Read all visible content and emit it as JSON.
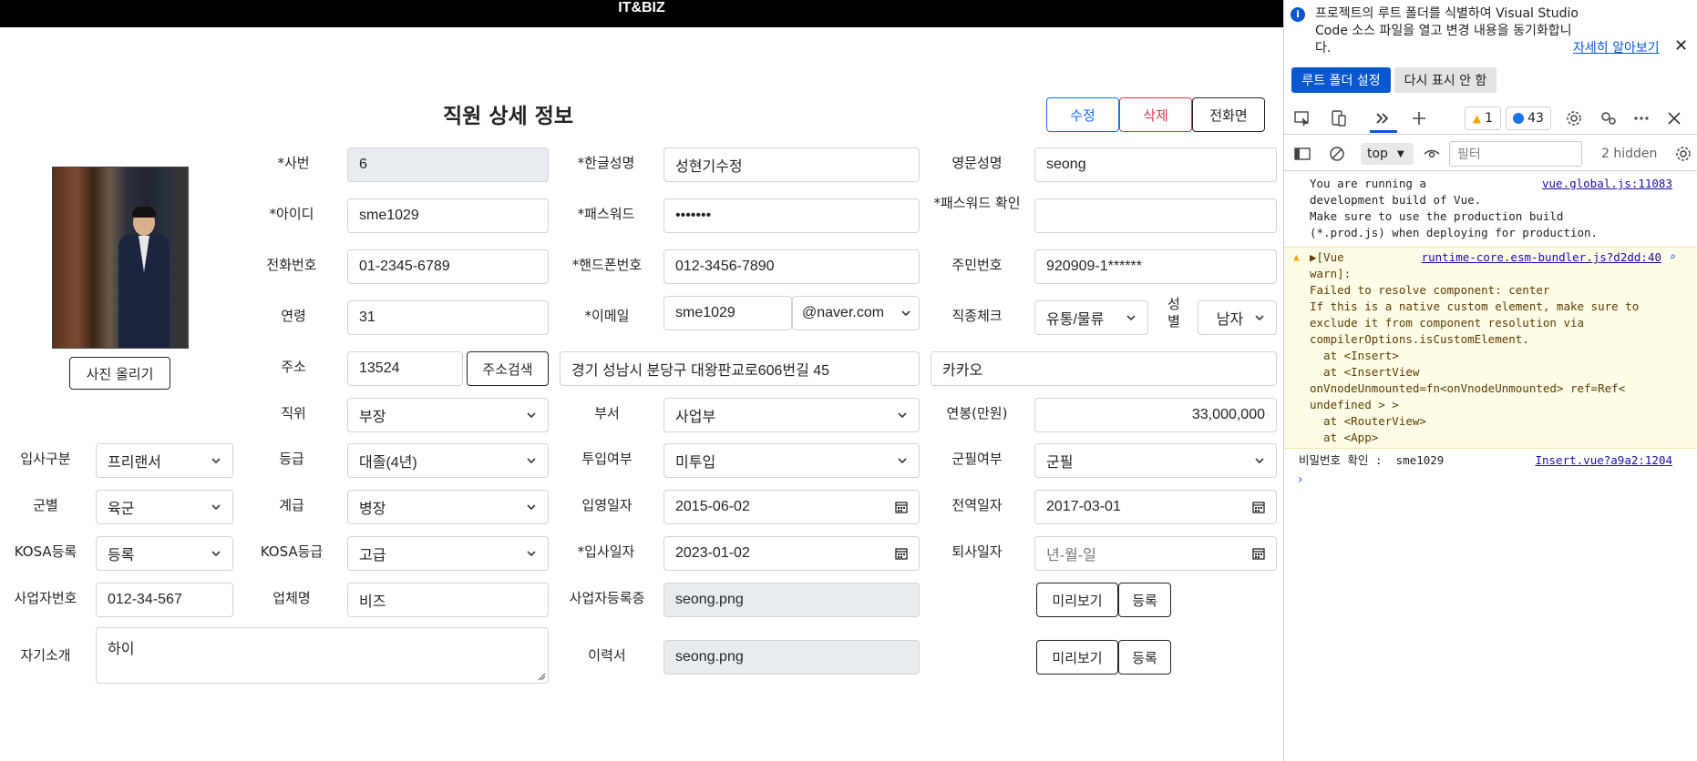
{
  "app": {
    "brand": "IT&BIZ"
  },
  "page": {
    "title": "직원 상세 정보"
  },
  "actions": {
    "edit": "수정",
    "delete": "삭제",
    "back": "전화면"
  },
  "photo": {
    "upload_label": "사진 올리기"
  },
  "form": {
    "emp_no": {
      "label": "*사번",
      "value": "6"
    },
    "name_kr": {
      "label": "*한글성명",
      "value": "성현기수정"
    },
    "name_en": {
      "label": "영문성명",
      "value": "seong"
    },
    "user_id": {
      "label": "*아이디",
      "value": "sme1029"
    },
    "password": {
      "label": "*패스워드",
      "value": "•••••••"
    },
    "password_confirm": {
      "label": "*패스워드 확인",
      "value": ""
    },
    "phone": {
      "label": "전화번호",
      "value": "01-2345-6789"
    },
    "mobile": {
      "label": "*핸드폰번호",
      "value": "012-3456-7890"
    },
    "resident_no": {
      "label": "주민번호",
      "value": "920909-1******"
    },
    "age": {
      "label": "연령",
      "value": "31"
    },
    "email": {
      "label": "*이메일",
      "value": "sme1029",
      "domain": "@naver.com"
    },
    "job_type": {
      "label": "직종체크",
      "value": "유통/물류"
    },
    "gender": {
      "label": "성별",
      "value": "남자"
    },
    "address": {
      "label": "주소",
      "zip": "13524",
      "search_label": "주소검색",
      "line1": "경기 성남시 분당구 대왕판교로606번길 45",
      "line2": "카카오"
    },
    "position": {
      "label": "직위",
      "value": "부장"
    },
    "department": {
      "label": "부서",
      "value": "사업부"
    },
    "salary": {
      "label": "연봉(만원)",
      "value": "33,000,000"
    },
    "hire_type": {
      "label": "입사구분",
      "value": "프리랜서"
    },
    "grade": {
      "label": "등급",
      "value": "대졸(4년)"
    },
    "deploy": {
      "label": "투입여부",
      "value": "미투입"
    },
    "military": {
      "label": "군필여부",
      "value": "군필"
    },
    "army_branch": {
      "label": "군별",
      "value": "육군"
    },
    "rank": {
      "label": "계급",
      "value": "병장"
    },
    "enlist_date": {
      "label": "입영일자",
      "value": "2015-06-02"
    },
    "discharge_date": {
      "label": "전역일자",
      "value": "2017-03-01"
    },
    "kosa_reg": {
      "label": "KOSA등록",
      "value": "등록"
    },
    "kosa_grade": {
      "label": "KOSA등급",
      "value": "고급"
    },
    "join_date": {
      "label": "*입사일자",
      "value": "2023-01-02"
    },
    "leave_date": {
      "label": "퇴사일자",
      "value": "년-월-일"
    },
    "biz_no": {
      "label": "사업자번호",
      "value": "012-34-567"
    },
    "company": {
      "label": "업체명",
      "value": "비즈"
    },
    "biz_cert": {
      "label": "사업자등록증",
      "value": "seong.png",
      "preview": "미리보기",
      "register": "등록"
    },
    "intro": {
      "label": "자기소개",
      "value": "하이"
    },
    "resume": {
      "label": "이력서",
      "value": "seong.png",
      "preview": "미리보기",
      "register": "등록"
    }
  },
  "devtools": {
    "infobar": {
      "message": "프로젝트의 루트 폴더를 식별하여 Visual Studio Code 소스 파일을 열고 변경 내용을 동기화합니다.",
      "learn_more": "자세히 알아보기",
      "set_root": "루트 폴더 설정",
      "dont_show": "다시 표시 안 함"
    },
    "warnings": "1",
    "messages": "43",
    "context": "top",
    "filter_placeholder": "필터",
    "hidden": "2 hidden",
    "console": [
      {
        "text": "You are running a\ndevelopment build of Vue.\nMake sure to use the production build\n(*.prod.js) when deploying for production.",
        "source": "vue.global.js:11083"
      },
      {
        "text": "▶[Vue\nwarn]:\nFailed to resolve component: center\nIf this is a native custom element, make sure to\nexclude it from component resolution via\ncompilerOptions.isCustomElement.\n  at <Insert>\n  at <InsertView\nonVnodeUnmounted=fn<onVnodeUnmounted> ref=Ref<\nundefined > >\n  at <RouterView>\n  at <App>",
        "source": "runtime-core.esm-bundler.js?d2dd:40"
      },
      {
        "text": "비밀번호 확인 :  sme1029",
        "source": "Insert.vue?a9a2:1204"
      }
    ]
  },
  "colors": {
    "primary": "#0d6efd",
    "danger": "#dc3545",
    "devtools_accent": "#0b57d0",
    "warn_bg": "#fefbe6"
  }
}
